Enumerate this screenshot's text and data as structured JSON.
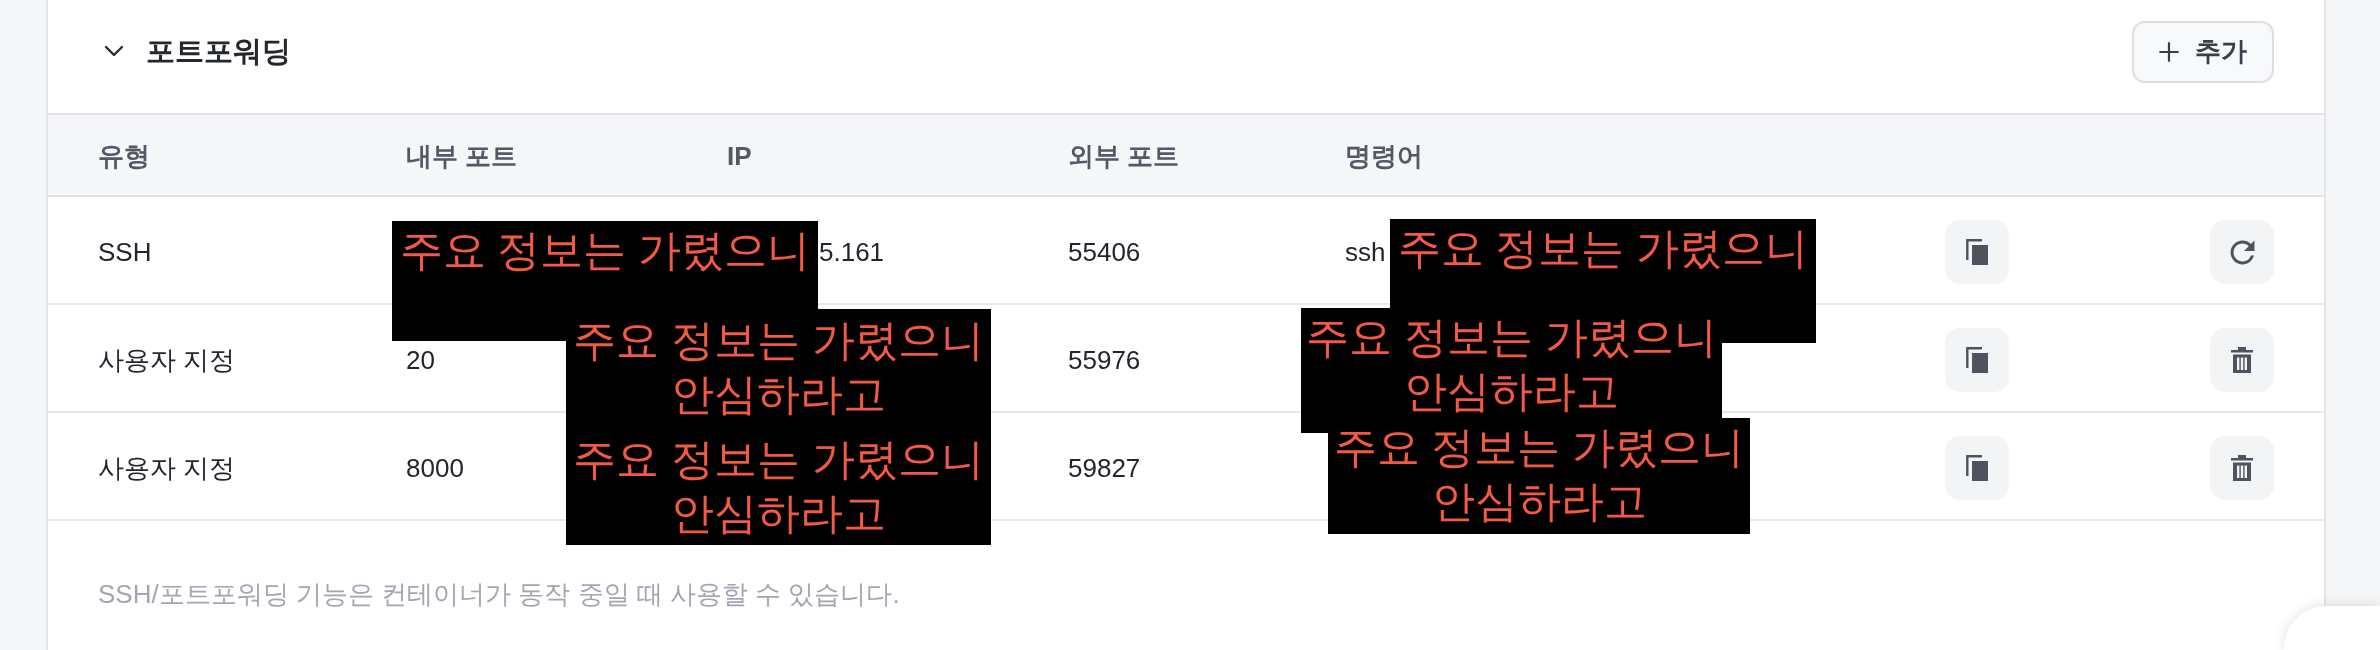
{
  "section": {
    "title": "포트포워딩",
    "expanded": true,
    "add_button": {
      "label": "추가"
    }
  },
  "table": {
    "columns": [
      "유형",
      "내부 포트",
      "IP",
      "외부 포트",
      "명령어"
    ],
    "rows": [
      {
        "kind": "ssh",
        "type": "SSH",
        "ip": "5.161",
        "ip_partial": true,
        "external_port": "55406",
        "command": "ssh"
      },
      {
        "kind": "custom",
        "type": "사용자 지정",
        "internal_port": "20",
        "external_port": "55976"
      },
      {
        "kind": "custom",
        "type": "사용자 지정",
        "internal_port": "8000",
        "external_port": "59827"
      }
    ]
  },
  "note": "SSH/포트포워딩 기능은 컨테이너가 동작 중일 때 사용할 수 있습니다.",
  "redactions": [
    {
      "lines": [
        "주요 정보는 가렸으니"
      ]
    },
    {
      "lines": [
        "주요 정보는 가렸으니",
        "안심하라고"
      ]
    },
    {
      "lines": [
        "주요 정보는 가렸으니",
        "안심하라고"
      ]
    },
    {
      "lines": [
        "주요 정보는 가렸으니"
      ]
    },
    {
      "lines": [
        "주요 정보는 가렸으니",
        "안심하라고"
      ]
    },
    {
      "lines": [
        "주요 정보는 가렸으니",
        "안심하라고"
      ]
    }
  ]
}
